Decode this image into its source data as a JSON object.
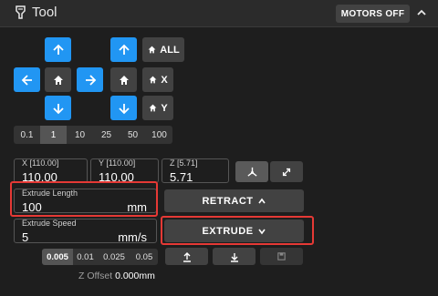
{
  "header": {
    "title": "Tool",
    "motors_off": "MOTORS OFF"
  },
  "jog": {
    "home_all": "ALL",
    "home_x": "X",
    "home_y": "Y",
    "steps": [
      "0.1",
      "1",
      "10",
      "25",
      "50",
      "100"
    ],
    "active_step": "1"
  },
  "position": {
    "x": {
      "label": "X [110.00]",
      "value": "110.00"
    },
    "y": {
      "label": "Y [110.00]",
      "value": "110.00"
    },
    "z": {
      "label": "Z [5.71]",
      "value": "5.71"
    }
  },
  "extrude": {
    "length_label": "Extrude Length",
    "length_value": "100",
    "length_unit": "mm",
    "speed_label": "Extrude Speed",
    "speed_value": "5",
    "speed_unit": "mm/s",
    "retract_label": "RETRACT",
    "extrude_label": "EXTRUDE"
  },
  "zoffset": {
    "steps": [
      "0.005",
      "0.01",
      "0.025",
      "0.05"
    ],
    "active_step": "0.005",
    "label": "Z Offset",
    "value": "0.000mm"
  }
}
